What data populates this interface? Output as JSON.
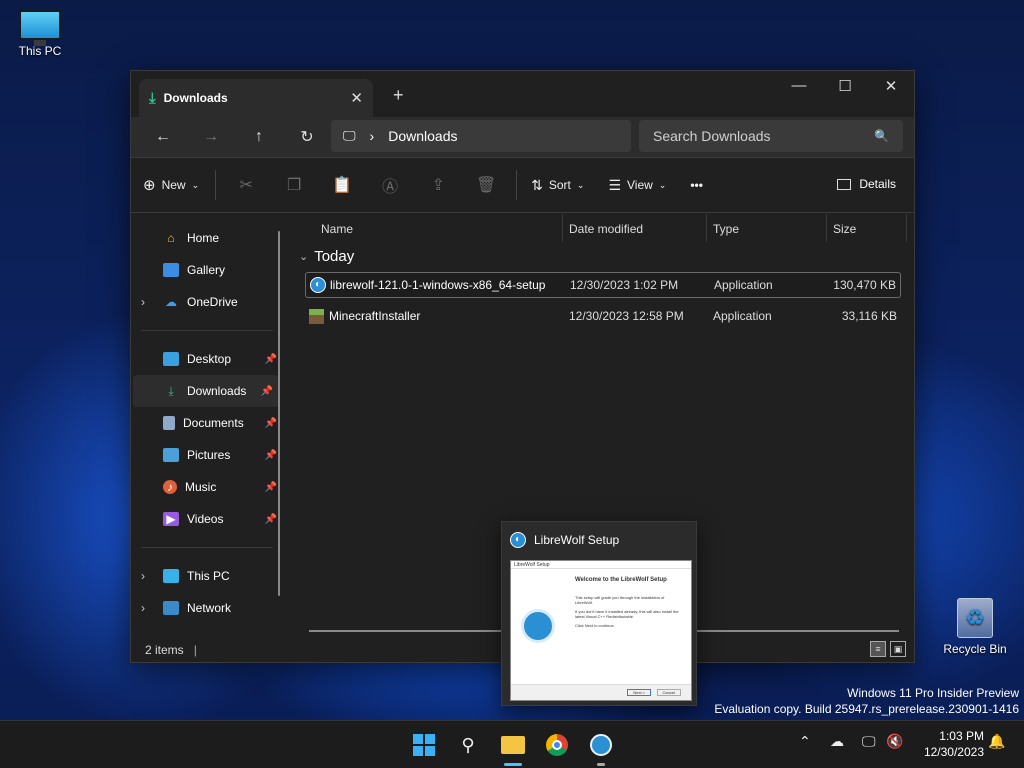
{
  "desktop": {
    "this_pc_label": "This PC",
    "recycle_bin_label": "Recycle Bin",
    "watermark_line1": "Windows 11 Pro Insider Preview",
    "watermark_line2": "Evaluation copy. Build 25947.rs_prerelease.230901-1416"
  },
  "window": {
    "tab_title": "Downloads",
    "tab_close": "✕",
    "new_tab": "+",
    "minimize": "—",
    "maximize": "☐",
    "close": "✕"
  },
  "nav": {
    "back": "←",
    "forward": "→",
    "up": "↑",
    "refresh": "↻",
    "breadcrumb_sep": "›",
    "current_folder": "Downloads",
    "search_placeholder": "Search Downloads"
  },
  "toolbar": {
    "new_label": "New",
    "sort_label": "Sort",
    "view_label": "View",
    "more": "•••",
    "details_label": "Details"
  },
  "sidebar": {
    "items": [
      {
        "label": "Home"
      },
      {
        "label": "Gallery"
      },
      {
        "label": "OneDrive"
      },
      {
        "label": "Desktop"
      },
      {
        "label": "Downloads"
      },
      {
        "label": "Documents"
      },
      {
        "label": "Pictures"
      },
      {
        "label": "Music"
      },
      {
        "label": "Videos"
      },
      {
        "label": "This PC"
      },
      {
        "label": "Network"
      }
    ]
  },
  "columns": {
    "name": "Name",
    "date": "Date modified",
    "type": "Type",
    "size": "Size"
  },
  "group_label": "Today",
  "files": [
    {
      "name": "librewolf-121.0-1-windows-x86_64-setup",
      "date": "12/30/2023 1:02 PM",
      "type": "Application",
      "size": "130,470 KB"
    },
    {
      "name": "MinecraftInstaller",
      "date": "12/30/2023 12:58 PM",
      "type": "Application",
      "size": "33,116 KB"
    }
  ],
  "status": {
    "items_count": "2 items"
  },
  "popup": {
    "title": "LibreWolf Setup",
    "thumb_title": "LibreWolf Setup",
    "thumb_heading": "Welcome to the LibreWolf Setup",
    "thumb_text1": "This setup will guide you through the installation of LibreWolf.",
    "thumb_text2": "If you don't have it installed already, this will also install the latest Visual C++ Redistributable.",
    "thumb_text3": "Click Next to continue.",
    "thumb_next": "Next >",
    "thumb_cancel": "Cancel"
  },
  "clock": {
    "time": "1:03 PM",
    "date": "12/30/2023"
  }
}
